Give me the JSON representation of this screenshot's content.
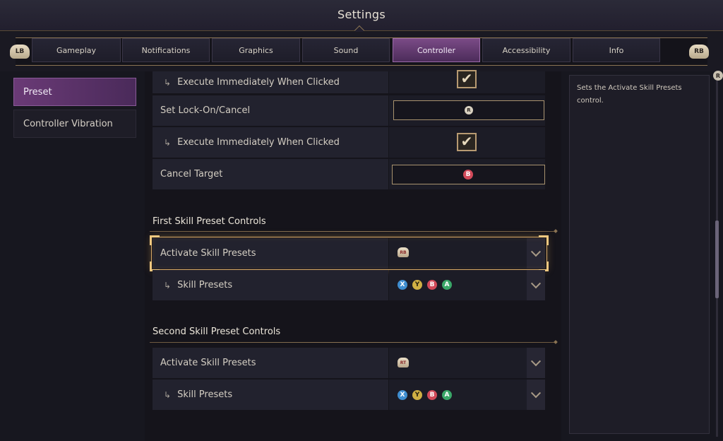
{
  "header": {
    "title": "Settings"
  },
  "tabbar": {
    "left_bumper": "LB",
    "right_bumper": "RB",
    "tabs": [
      {
        "label": "Gameplay"
      },
      {
        "label": "Notifications"
      },
      {
        "label": "Graphics"
      },
      {
        "label": "Sound"
      },
      {
        "label": "Controller",
        "active": true
      },
      {
        "label": "Accessibility"
      },
      {
        "label": "Info"
      }
    ]
  },
  "sidebar": {
    "items": [
      {
        "label": "Preset",
        "active": true
      },
      {
        "label": "Controller Vibration"
      }
    ]
  },
  "rows_top": [
    {
      "label": "Execute Immediately When Clicked",
      "sub": true,
      "type": "checkbox",
      "checked": true
    },
    {
      "label": "Set Lock-On/Cancel",
      "type": "key",
      "key": "R"
    },
    {
      "label": "Execute Immediately When Clicked",
      "sub": true,
      "type": "checkbox",
      "checked": true
    },
    {
      "label": "Cancel Target",
      "type": "key",
      "key": "B"
    }
  ],
  "sections": [
    {
      "title": "First Skill Preset Controls",
      "rows": [
        {
          "label": "Activate Skill Presets",
          "button": "RB"
        },
        {
          "label": "Skill Presets",
          "sub": true,
          "buttons": [
            "X",
            "Y",
            "B",
            "A"
          ]
        }
      ]
    },
    {
      "title": "Second Skill Preset Controls",
      "rows": [
        {
          "label": "Activate Skill Presets",
          "button": "RT"
        },
        {
          "label": "Skill Presets",
          "sub": true,
          "buttons": [
            "X",
            "Y",
            "B",
            "A"
          ]
        }
      ]
    }
  ],
  "description": {
    "text": "Sets the Activate Skill Presets control."
  },
  "scrollbar": {
    "button": "R"
  },
  "sub_arrow": "↳",
  "check_glyph": "✔",
  "colors": {
    "accent_purple": "#6a3a76",
    "accent_gold": "#d8aa68"
  }
}
